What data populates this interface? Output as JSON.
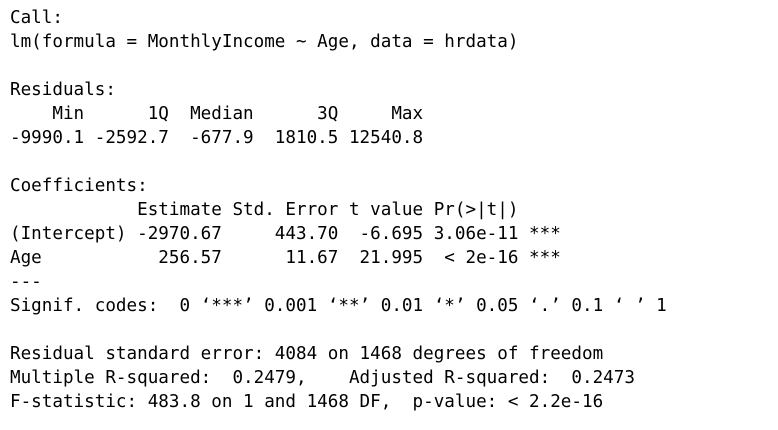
{
  "console": {
    "call": {
      "header": "Call:",
      "formula": "lm(formula = MonthlyIncome ~ Age, data = hrdata)"
    },
    "residuals": {
      "header": "Residuals:",
      "labels": "    Min      1Q  Median      3Q     Max ",
      "values": "-9990.1 -2592.7  -677.9  1810.5 12540.8 "
    },
    "coefficients": {
      "header": "Coefficients:",
      "column_headers": "            Estimate Std. Error t value Pr(>|t|)    ",
      "rows": [
        "(Intercept) -2970.67     443.70  -6.695 3.06e-11 ***",
        "Age           256.57      11.67  21.995  < 2e-16 ***"
      ],
      "separator": "---",
      "signif_codes": "Signif. codes:  0 ‘***’ 0.001 ‘**’ 0.01 ‘*’ 0.05 ‘.’ 0.1 ‘ ’ 1"
    },
    "summary": {
      "residual_se": "Residual standard error: 4084 on 1468 degrees of freedom",
      "r_squared": "Multiple R-squared:  0.2479,\tAdjusted R-squared:  0.2473 ",
      "f_statistic": "F-statistic: 483.8 on 1 and 1468 DF,  p-value: < 2.2e-16"
    }
  }
}
